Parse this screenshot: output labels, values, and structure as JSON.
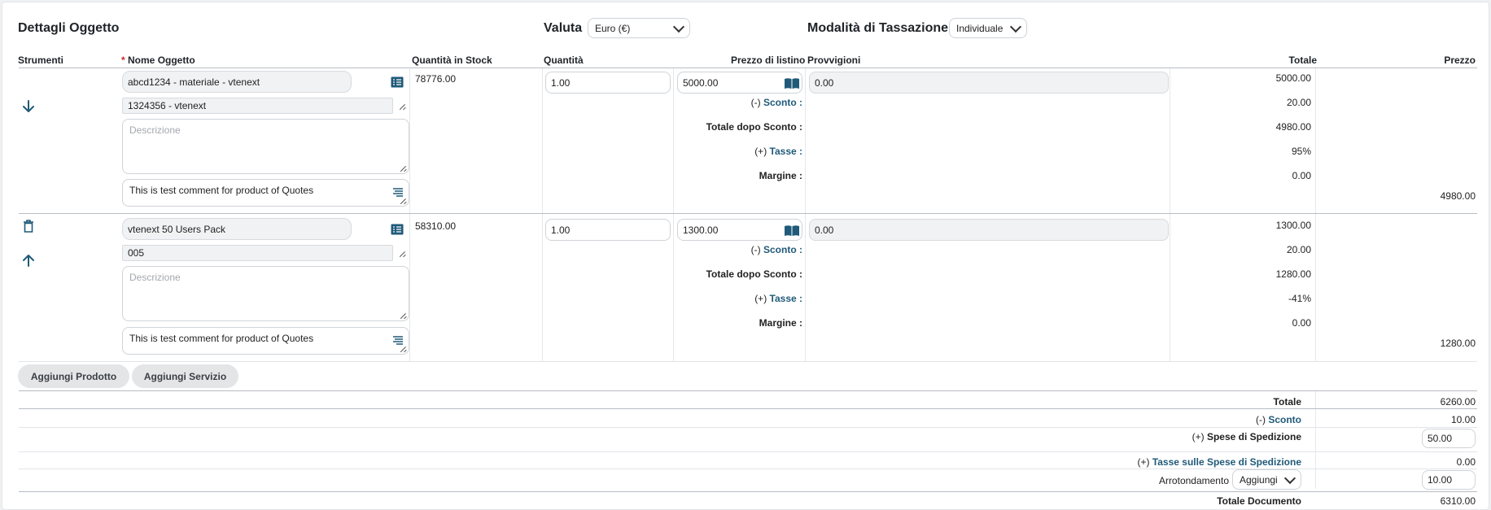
{
  "header": {
    "title": "Dettagli Oggetto",
    "currency_label": "Valuta",
    "currency_value": "Euro (€)",
    "tax_mode_label": "Modalità di Tassazione",
    "tax_mode_value": "Individuale"
  },
  "columns": {
    "tools": "Strumenti",
    "required_mark": "*",
    "name": "Nome Oggetto",
    "stock": "Quantità in Stock",
    "quantity": "Quantità",
    "list_price": "Prezzo di listino",
    "commissions": "Provvigioni",
    "total": "Totale",
    "price": "Prezzo"
  },
  "row_labels": {
    "discount_prefix": "(-)",
    "discount": "Sconto :",
    "total_after_discount": "Totale dopo Sconto :",
    "tax_prefix": "(+)",
    "tax": "Tasse :",
    "margin": "Margine :"
  },
  "rows": [
    {
      "product": "abcd1234 - materiale - vtenext",
      "code": "1324356 - vtenext",
      "description_placeholder": "Descrizione",
      "comment": "This is test comment for product of Quotes",
      "stock": "78776.00",
      "quantity": "1.00",
      "list_price": "5000.00",
      "commission": "0.00",
      "total": "5000.00",
      "discount": "20.00",
      "total_after_discount": "4980.00",
      "tax": "95%",
      "margin": "0.00",
      "net_price": "4980.00"
    },
    {
      "product": "vtenext 50 Users Pack",
      "code": "005",
      "description_placeholder": "Descrizione",
      "comment": "This is test comment for product of Quotes",
      "stock": "58310.00",
      "quantity": "1.00",
      "list_price": "1300.00",
      "commission": "0.00",
      "total": "1300.00",
      "discount": "20.00",
      "total_after_discount": "1280.00",
      "tax": "-41%",
      "margin": "0.00",
      "net_price": "1280.00"
    }
  ],
  "buttons": {
    "add_product": "Aggiungi Prodotto",
    "add_service": "Aggiungi Servizio"
  },
  "summary": {
    "total_label": "Totale",
    "total_value": "6260.00",
    "discount_prefix": "(-)",
    "discount_label": "Sconto",
    "discount_value": "10.00",
    "shipping_prefix": "(+)",
    "shipping_label": "Spese di Spedizione",
    "shipping_value": "50.00",
    "shipping_tax_prefix": "(+)",
    "shipping_tax_label": "Tasse sulle Spese di Spedizione",
    "shipping_tax_value": "0.00",
    "rounding_label": "Arrotondamento",
    "rounding_mode": "Aggiungi",
    "rounding_value": "10.00",
    "document_total_label": "Totale Documento",
    "document_total_value": "6310.00"
  },
  "icons": [
    "arrow-down-icon",
    "arrow-up-icon",
    "trash-icon",
    "list-icon",
    "book-icon",
    "comment-lines-icon",
    "resize-grip-icon",
    "chevron-down-icon"
  ],
  "colors": {
    "accent": "#1f5a79",
    "readonly_field": "#f1f2f4",
    "button": "#e4e5e7"
  }
}
